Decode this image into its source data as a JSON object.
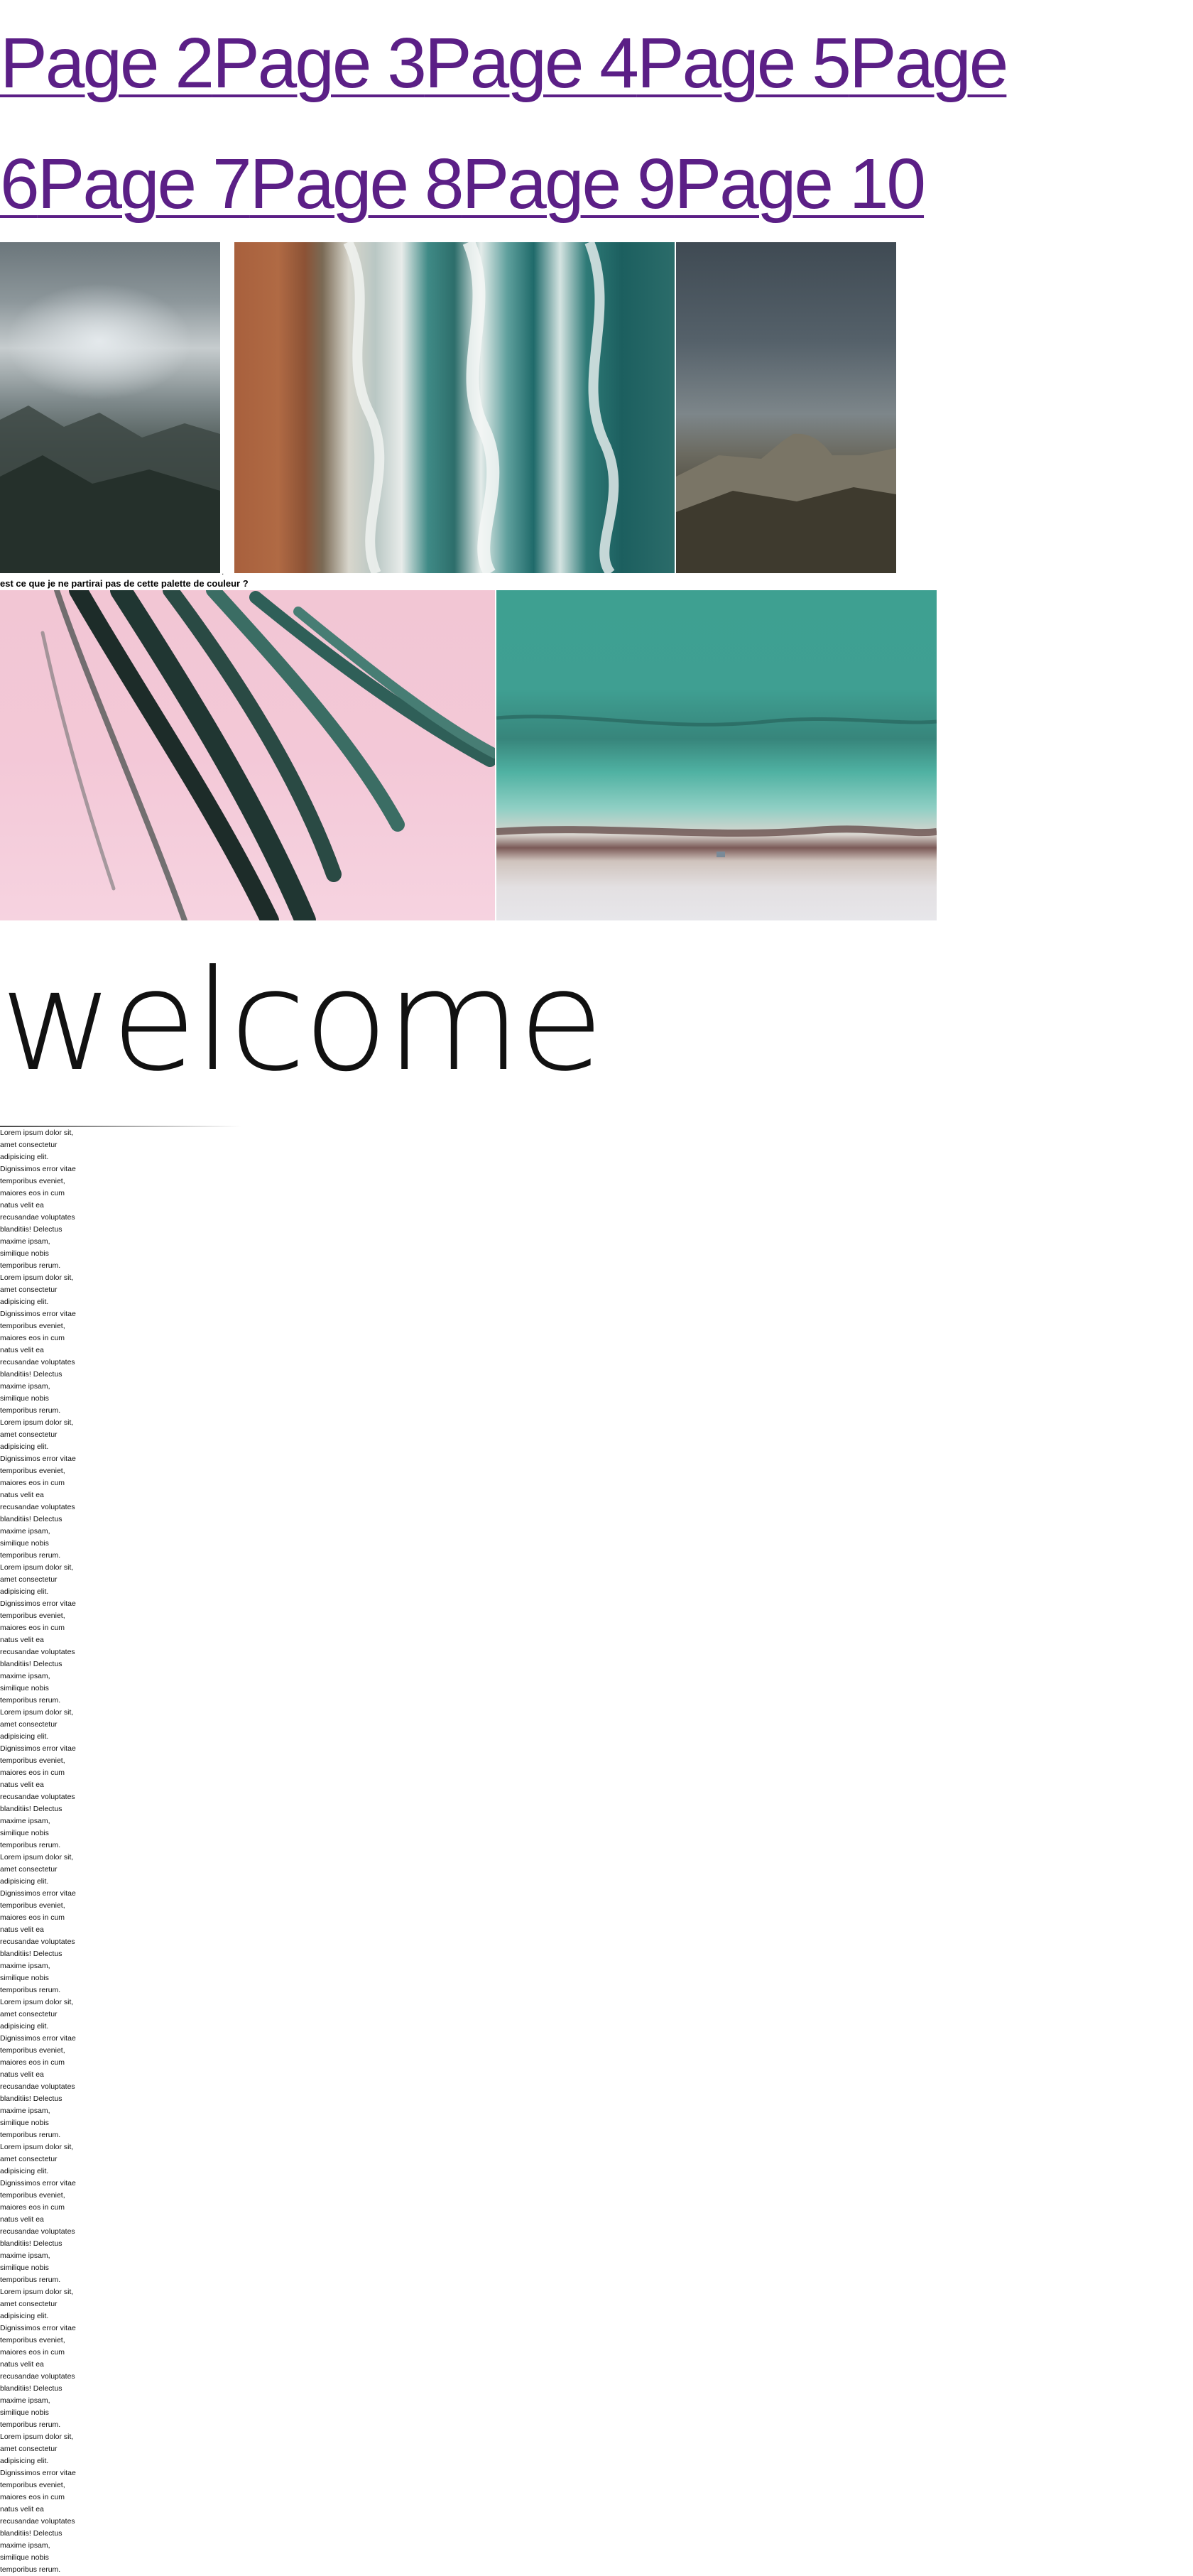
{
  "nav": {
    "links": [
      "Page 2",
      "Page 3",
      "Page 4",
      "Page 5",
      "Page 6",
      "Page 7",
      "Page 8",
      "Page 9",
      "Page 10"
    ]
  },
  "gallery": {
    "row1": [
      {
        "name": "cloudy-valley-photo"
      },
      {
        "name": "aerial-shoreline-photo"
      },
      {
        "name": "half-dome-photo"
      }
    ],
    "caption": "est ce que je ne partirai pas de cette palette de couleur ?",
    "row2": [
      {
        "name": "palm-leaf-pink-photo"
      },
      {
        "name": "aerial-beach-photo"
      }
    ]
  },
  "welcome": {
    "title": "welcome"
  },
  "body": {
    "paragraph": "Lorem ipsum dolor sit, amet consectetur adipisicing elit. Dignissimos error vitae temporibus eveniet, maiores eos in cum natus velit ea recusandae voluptates blanditiis! Delectus maxime ipsam, similique nobis temporibus rerum.",
    "repeat": 10
  },
  "colors": {
    "link": "#5b1f86",
    "background": "#ffffff",
    "text": "#000000"
  }
}
